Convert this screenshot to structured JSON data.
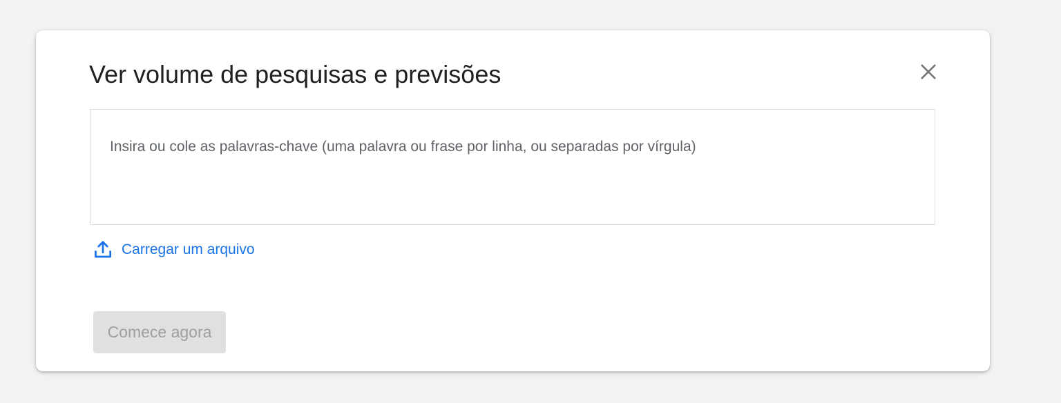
{
  "dialog": {
    "title": "Ver volume de pesquisas e previsões",
    "close_icon": "close-icon",
    "keyword_input": {
      "placeholder": "Insira ou cole as palavras-chave (uma palavra ou frase por linha, ou separadas por vírgula)",
      "value": ""
    },
    "upload": {
      "icon": "upload-icon",
      "label": "Carregar um arquivo"
    },
    "start_button": {
      "label": "Comece agora",
      "disabled": true
    }
  },
  "colors": {
    "background": "#f1f2f4",
    "dialog": "#ffffff",
    "link": "#1a73e8",
    "title": "#202124",
    "placeholder": "#5f6368",
    "disabled_button_bg": "#e0e0e0",
    "disabled_button_text": "#9e9e9e"
  }
}
